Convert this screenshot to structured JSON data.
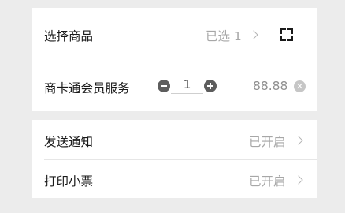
{
  "product_card": {
    "select_label": "选择商品",
    "select_status": "已选 1",
    "service_label": "商卡通会员服务",
    "quantity": "1",
    "price": "88.88",
    "icons": [
      "chevron-right-icon",
      "scan-icon",
      "minus-icon",
      "plus-icon",
      "close-icon"
    ]
  },
  "settings_card": {
    "items": [
      {
        "label": "发送通知",
        "status": "已开启"
      },
      {
        "label": "打印小票",
        "status": "已开启"
      }
    ]
  },
  "colors": {
    "background": "#ececec",
    "card": "#ffffff",
    "text": "#1a1a1a",
    "muted": "#a7a7a7",
    "stepper": "#5d5d5d"
  }
}
